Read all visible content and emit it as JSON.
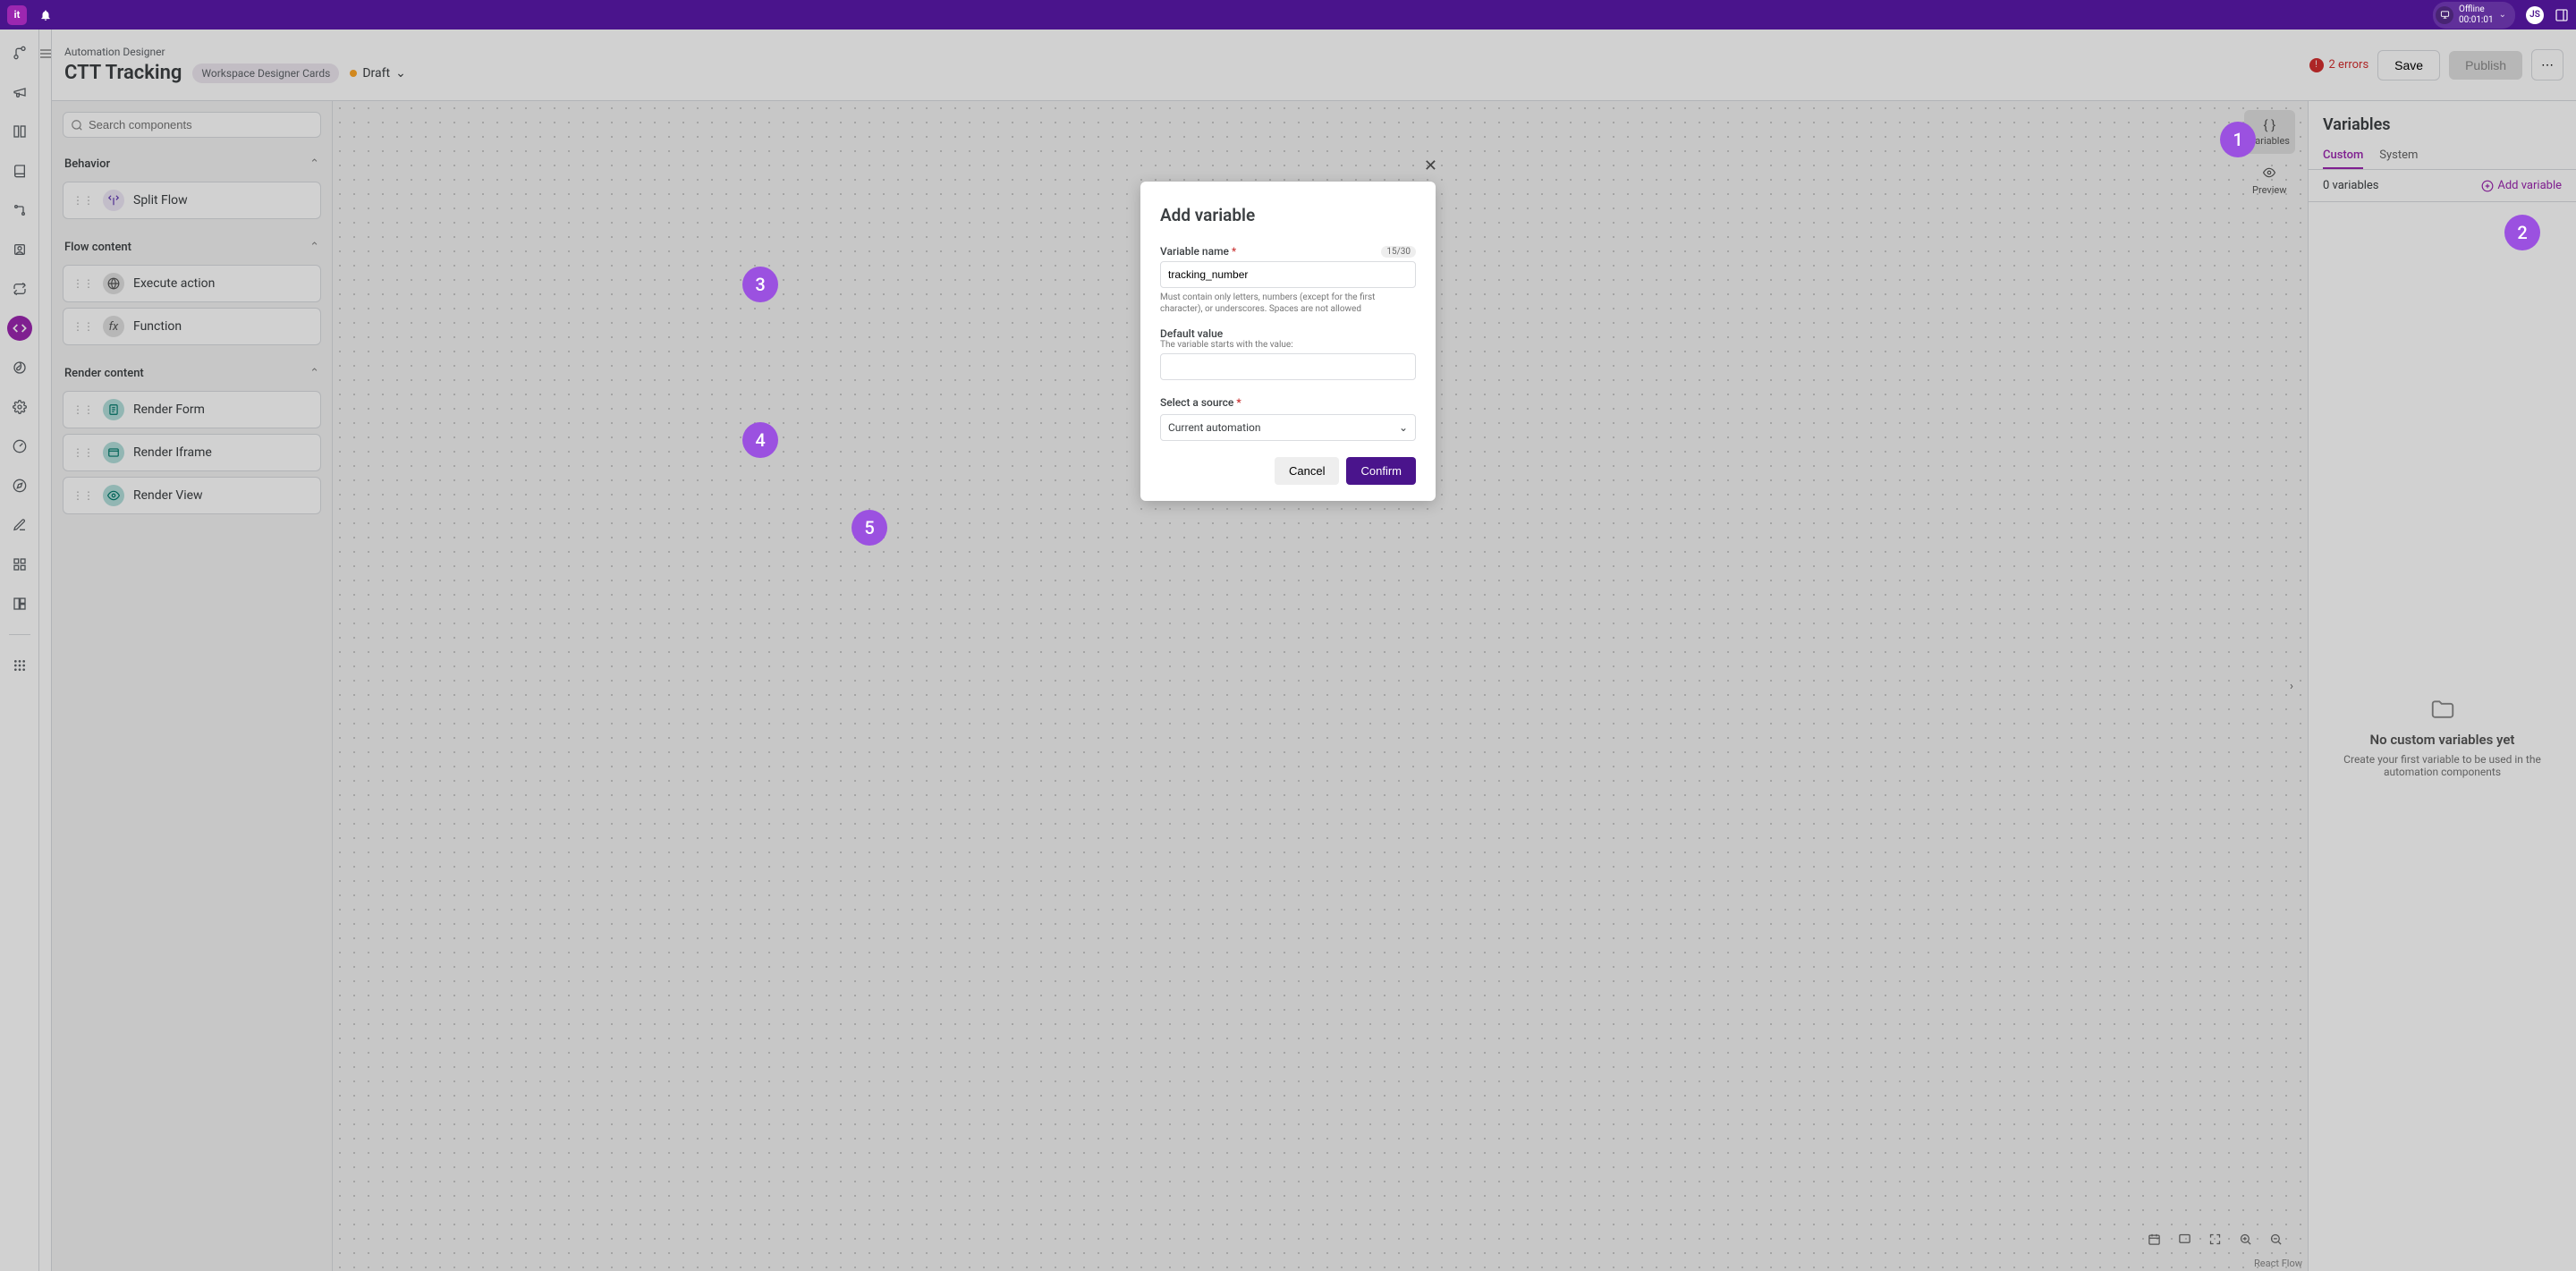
{
  "topbar": {
    "logo_text": "it",
    "status": {
      "label": "Offline",
      "timer": "00:01:01"
    },
    "avatar_initials": "JS"
  },
  "breadcrumb": "Automation Designer",
  "page_title": "CTT Tracking",
  "workspace_chip": "Workspace Designer Cards",
  "draft_label": "Draft",
  "errors_label": "2 errors",
  "buttons": {
    "save": "Save",
    "publish": "Publish"
  },
  "search_placeholder": "Search components",
  "sections": {
    "behavior": {
      "title": "Behavior",
      "items": [
        "Split Flow"
      ]
    },
    "flow_content": {
      "title": "Flow content",
      "items": [
        "Execute action",
        "Function"
      ]
    },
    "render_content": {
      "title": "Render content",
      "items": [
        "Render Form",
        "Render Iframe",
        "Render View"
      ]
    }
  },
  "canvas_tools": {
    "variables": "Variables",
    "preview": "Preview"
  },
  "canvas_footer": "React Flow",
  "vars_panel": {
    "title": "Variables",
    "tabs": {
      "custom": "Custom",
      "system": "System"
    },
    "count_label": "0 variables",
    "add_label": "Add variable",
    "empty_title": "No custom variables yet",
    "empty_body": "Create your first variable to be used in the automation components"
  },
  "modal": {
    "title": "Add variable",
    "name_label": "Variable name",
    "name_value": "tracking_number",
    "name_counter": "15/30",
    "name_helper": "Must contain only letters, numbers (except for the first character), or underscores. Spaces are not allowed",
    "default_label": "Default value",
    "default_sub": "The variable starts with the value:",
    "default_value": "",
    "source_label": "Select a source",
    "source_value": "Current automation",
    "cancel": "Cancel",
    "confirm": "Confirm"
  },
  "callouts": [
    "1",
    "2",
    "3",
    "4",
    "5"
  ]
}
